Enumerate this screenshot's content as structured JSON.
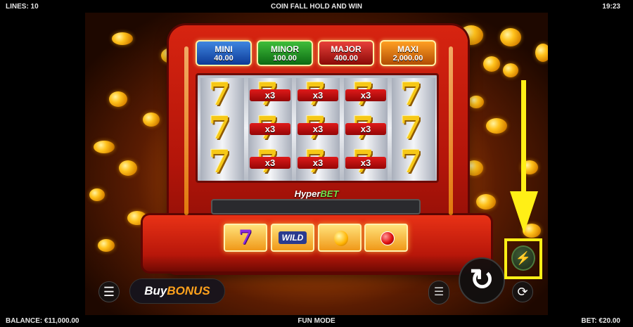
{
  "top_bar": {
    "lines": "LINES: 10",
    "title": "COIN FALL HOLD AND WIN",
    "clock": "19:23"
  },
  "bottom_bar": {
    "balance": "BALANCE: €11,000.00",
    "mode": "FUN MODE",
    "bet": "BET: €20.00"
  },
  "jackpots": [
    {
      "name": "MINI",
      "value": "40.00",
      "color": "#1f5fc4"
    },
    {
      "name": "MINOR",
      "value": "100.00",
      "color": "#1f9a24"
    },
    {
      "name": "MAJOR",
      "value": "400.00",
      "color": "#c0170f"
    },
    {
      "name": "MAXI",
      "value": "2,000.00",
      "color": "#e06d0c"
    }
  ],
  "reels": {
    "multiplier_label": "x3",
    "grid": [
      [
        "seven",
        "seven",
        "seven"
      ],
      [
        "x3",
        "x3",
        "x3"
      ],
      [
        "x3",
        "x3",
        "x3"
      ],
      [
        "x3",
        "x3",
        "x3"
      ],
      [
        "seven",
        "seven",
        "seven"
      ]
    ]
  },
  "hyperbet": {
    "logo_part1": "Hyper",
    "logo_part2": "BET",
    "slots": [
      {
        "symbol": "seven",
        "label": "7"
      },
      {
        "symbol": "wild",
        "label": "WILD"
      },
      {
        "symbol": "gold-coin"
      },
      {
        "symbol": "red-gem"
      }
    ]
  },
  "controls": {
    "menu_icon": "menu-icon",
    "buy_label": "Buy",
    "bonus_label": "BONUS",
    "stake_icon": "coin-stack-icon",
    "spin_icon": "spin-arrow-icon",
    "autoplay_icon": "autoplay-icon",
    "turbo_icon": "lightning-icon"
  },
  "colors": {
    "accent_highlight": "#ffef16",
    "cabinet_red": "#c81b0c",
    "bonus_orange": "#ffa21c",
    "hyperbet_green": "#6ee34b"
  }
}
